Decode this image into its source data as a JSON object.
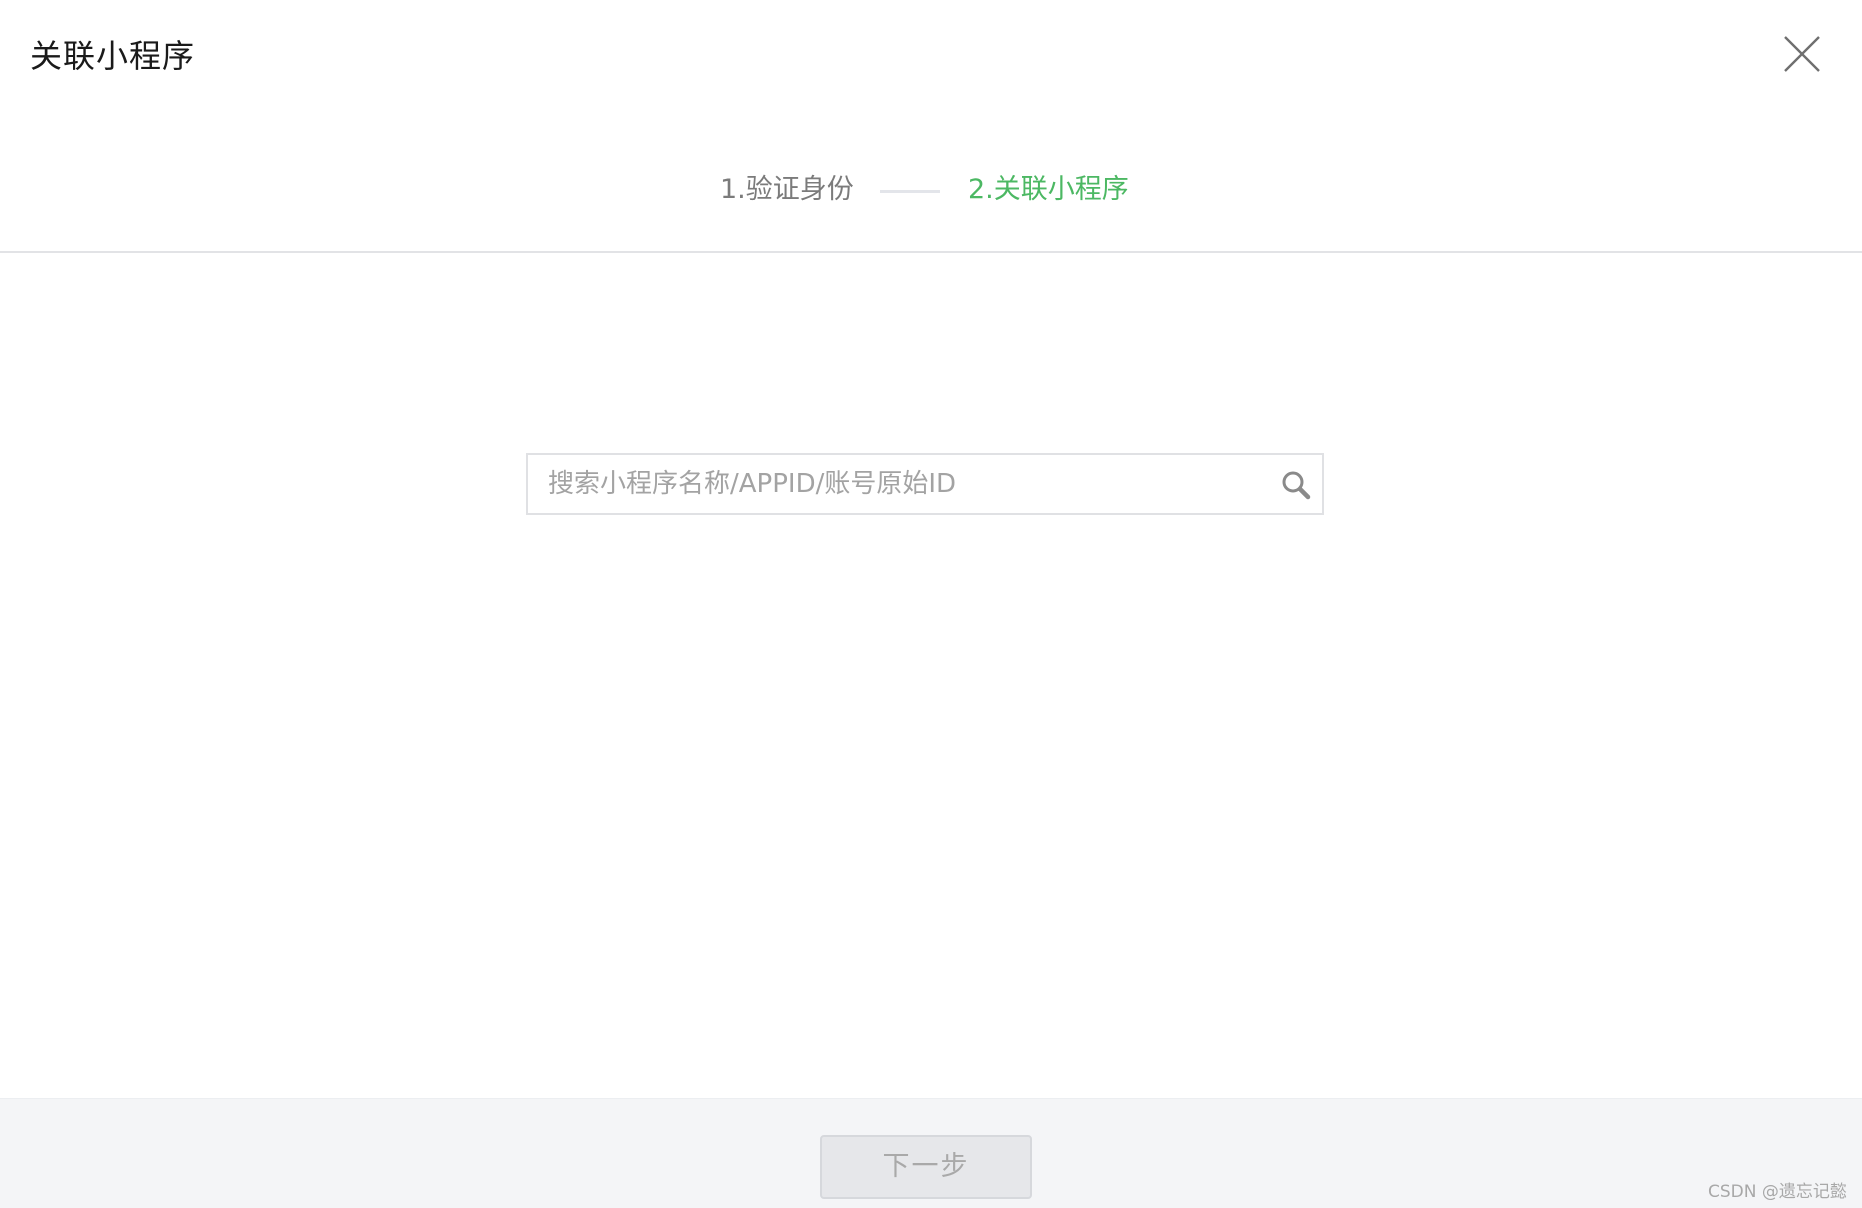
{
  "dialog": {
    "title": "关联小程序",
    "close_icon": "close-icon"
  },
  "steps": [
    {
      "label": "1.验证身份",
      "state": "done",
      "color": "#7b7b7b"
    },
    {
      "label": "2.关联小程序",
      "state": "active",
      "color": "#4cb863"
    }
  ],
  "search": {
    "placeholder": "搜索小程序名称/APPID/账号原始ID",
    "value": "",
    "icon": "search-icon"
  },
  "footer": {
    "next_label": "下一步",
    "next_disabled": true
  },
  "watermark": "CSDN @遗忘记懿",
  "colors": {
    "accent": "#4cb863",
    "muted_text": "#7b7b7b",
    "footer_bg": "#f4f5f7"
  }
}
